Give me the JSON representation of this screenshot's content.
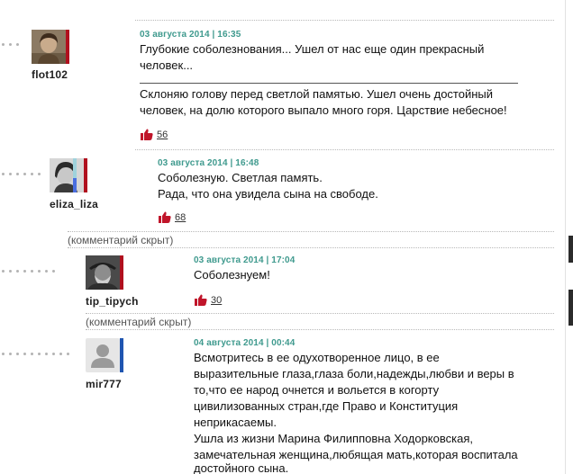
{
  "colors": {
    "date": "#3f9a8e",
    "like_icon": "#c0152a",
    "accent_red": "#b0101e",
    "accent_blue": "#1f55b0",
    "divider": "#b9b9b9"
  },
  "hidden_label": "(комментарий скрыт)",
  "comments": [
    {
      "user": "flot102",
      "date": "03 августа 2014 | 16:35",
      "lines": [
        "Глубокие соболезнования... Ушел от нас еще один прекрасный",
        "человек...",
        "Склоняю голову перед светлой памятью. Ушел очень достойный",
        "человек, на долю которого выпало много горя. Царствие небесное!"
      ],
      "likes": "56",
      "like_icon": "thumbs-up-icon"
    },
    {
      "user": "eliza_liza",
      "date": "03 августа 2014 | 16:48",
      "lines": [
        "Соболезную. Светлая память.",
        "Рада, что она увидела сына на свободе."
      ],
      "likes": "68",
      "like_icon": "thumbs-up-icon"
    },
    {
      "user": "tip_tipych",
      "date": "03 августа 2014 | 17:04",
      "lines": [
        "Соболезнуем!"
      ],
      "likes": "30",
      "like_icon": "thumbs-up-icon"
    },
    {
      "user": "mir777",
      "date": "04 августа 2014 | 00:44",
      "lines": [
        "Всмотритесь в ее одухотворенное лицо, в ее",
        "выразительные глаза,глаза боли,надежды,любви и веры в",
        "то,что ее народ очнется и вольется в когорту",
        "цивилизованных стран,где Право и Конституция",
        "неприкасаемы.",
        "Ушла из жизни Марина Филипповна Ходорковская,",
        "замечательная женщина,любящая мать,которая воспитала",
        "достойного сына."
      ]
    }
  ]
}
